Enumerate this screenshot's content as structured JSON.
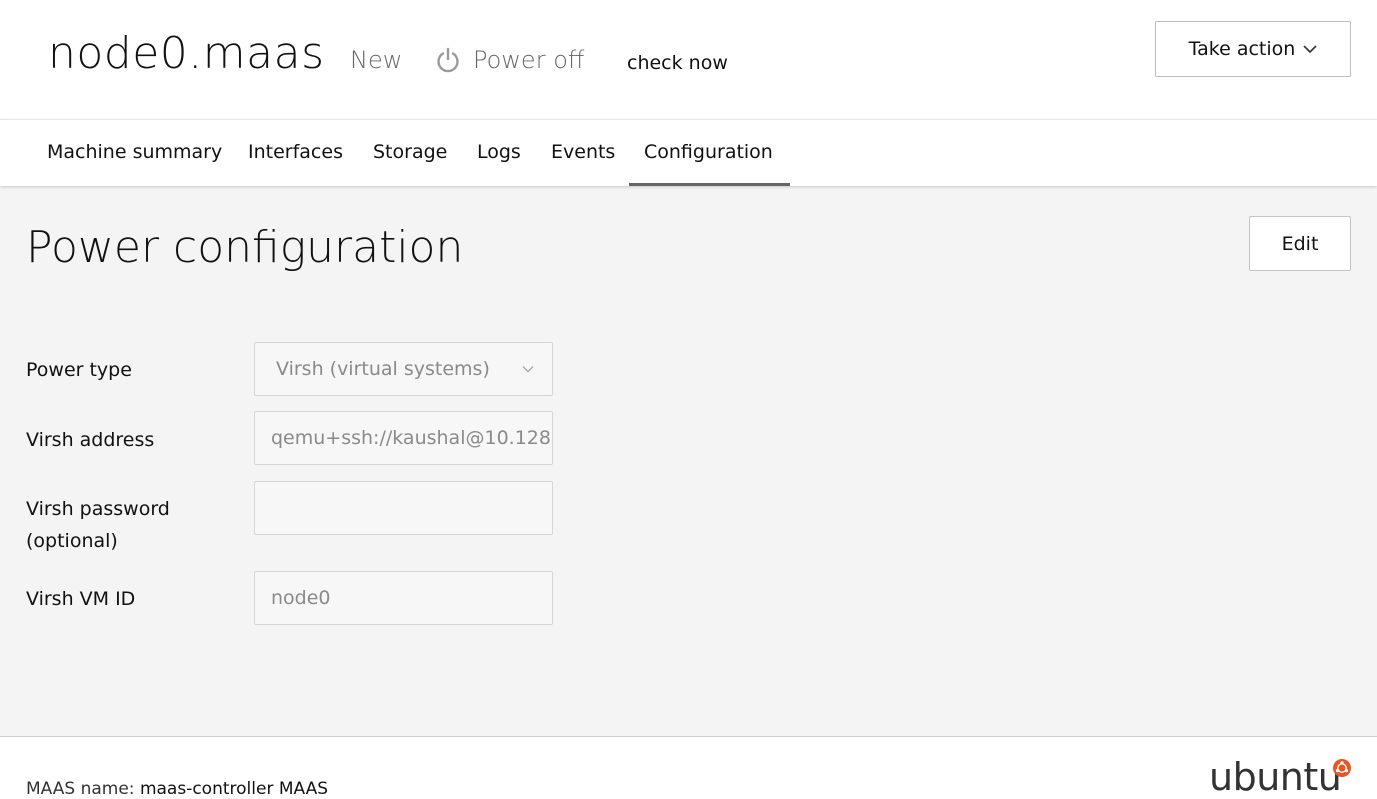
{
  "header": {
    "machine_name": "node0.maas",
    "status": "New",
    "power_state": "Power off",
    "check_now": "check now",
    "take_action": "Take action"
  },
  "tabs": [
    {
      "label": "Machine summary"
    },
    {
      "label": "Interfaces"
    },
    {
      "label": "Storage"
    },
    {
      "label": "Logs"
    },
    {
      "label": "Events"
    },
    {
      "label": "Configuration",
      "active": true
    }
  ],
  "main": {
    "title": "Power configuration",
    "edit_label": "Edit",
    "fields": {
      "power_type": {
        "label": "Power type",
        "value": "Virsh (virtual systems)"
      },
      "virsh_address": {
        "label": "Virsh address",
        "value": "qemu+ssh://kaushal@10.128"
      },
      "virsh_password": {
        "label_line1": "Virsh password",
        "label_line2": "(optional)",
        "value": ""
      },
      "virsh_vm_id": {
        "label": "Virsh VM ID",
        "value": "node0"
      }
    }
  },
  "footer": {
    "maas_name_label": "MAAS name:",
    "maas_name_value": "maas-controller MAAS",
    "brand": "ubuntu"
  },
  "colors": {
    "background_main": "#f4f4f4",
    "tab_active_underline": "#666666",
    "ubuntu_orange": "#e95420"
  },
  "icons": {
    "power": "power-icon",
    "take_action_chevron": "chevron-down-icon",
    "select_chevron": "chevron-down-icon",
    "ubuntu": "ubuntu-circle-of-friends-icon"
  }
}
